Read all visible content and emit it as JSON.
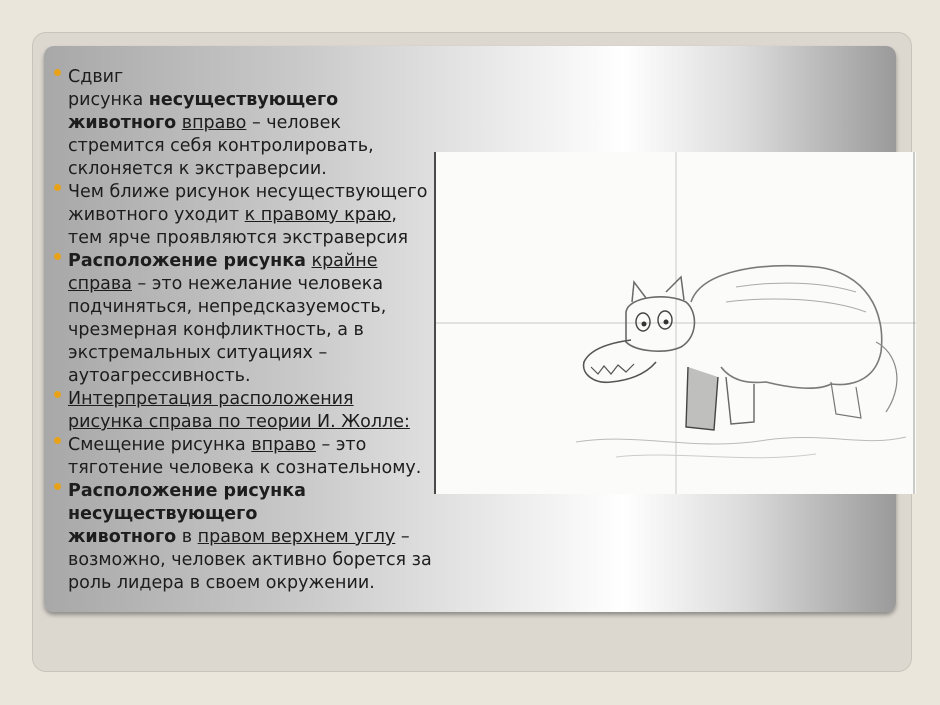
{
  "slide": {
    "paragraphs": [
      {
        "segments": [
          {
            "text": "Сдвиг",
            "bold": false,
            "underline": false
          },
          {
            "br": true
          },
          {
            "text": "рисунка ",
            "bold": false,
            "underline": false
          },
          {
            "text": "несуществующего",
            "bold": true,
            "underline": false
          },
          {
            "br": true
          },
          {
            "text": "животного",
            "bold": true,
            "underline": false
          },
          {
            "text": " ",
            "bold": false,
            "underline": false
          },
          {
            "text": "вправо",
            "bold": false,
            "underline": true
          },
          {
            "text": " – человек стремится себя контролировать, склоняется к экстраверсии.",
            "bold": false,
            "underline": false
          }
        ]
      },
      {
        "segments": [
          {
            "text": "Чем ближе рисунок несуществующего животного уходит ",
            "bold": false,
            "underline": false
          },
          {
            "text": "к правому краю",
            "bold": false,
            "underline": true
          },
          {
            "text": ", тем ярче проявляются  экстраверсия",
            "bold": false,
            "underline": false
          }
        ]
      },
      {
        "segments": [
          {
            "text": "Расположение рисунка",
            "bold": true,
            "underline": false
          },
          {
            "text": " ",
            "bold": false,
            "underline": false
          },
          {
            "text": "крайне справа",
            "bold": false,
            "underline": true
          },
          {
            "text": " – это нежелание человека подчиняться, непредсказуемость, чрезмерная конфликтность, а в экстремальных ситуациях – аутоагрессивность.",
            "bold": false,
            "underline": false
          }
        ]
      },
      {
        "segments": [
          {
            "text": "Интерпретация расположения рисунка справа по теории И. Жолле:",
            "bold": false,
            "underline": true
          }
        ]
      },
      {
        "segments": [
          {
            "text": "Смещение рисунка ",
            "bold": false,
            "underline": false
          },
          {
            "text": "вправо",
            "bold": false,
            "underline": true
          },
          {
            "text": " – это тяготение человека к сознательному.",
            "bold": false,
            "underline": false
          }
        ]
      },
      {
        "segments": [
          {
            "text": "Расположение рисунка",
            "bold": true,
            "underline": false
          },
          {
            "br": true
          },
          {
            "text": " несуществующего",
            "bold": true,
            "underline": false
          },
          {
            "br": true
          },
          {
            "text": "животного",
            "bold": true,
            "underline": false
          },
          {
            "text": " в ",
            "bold": false,
            "underline": false
          },
          {
            "text": "правом верхнем углу",
            "bold": false,
            "underline": true
          },
          {
            "text": " – возможно, человек активно борется за роль лидера в своем окружении.",
            "bold": false,
            "underline": false
          }
        ]
      }
    ],
    "bullet_color": "#e8a21a"
  },
  "drawing": {
    "icon": "pencil-sketch-animal-icon"
  }
}
